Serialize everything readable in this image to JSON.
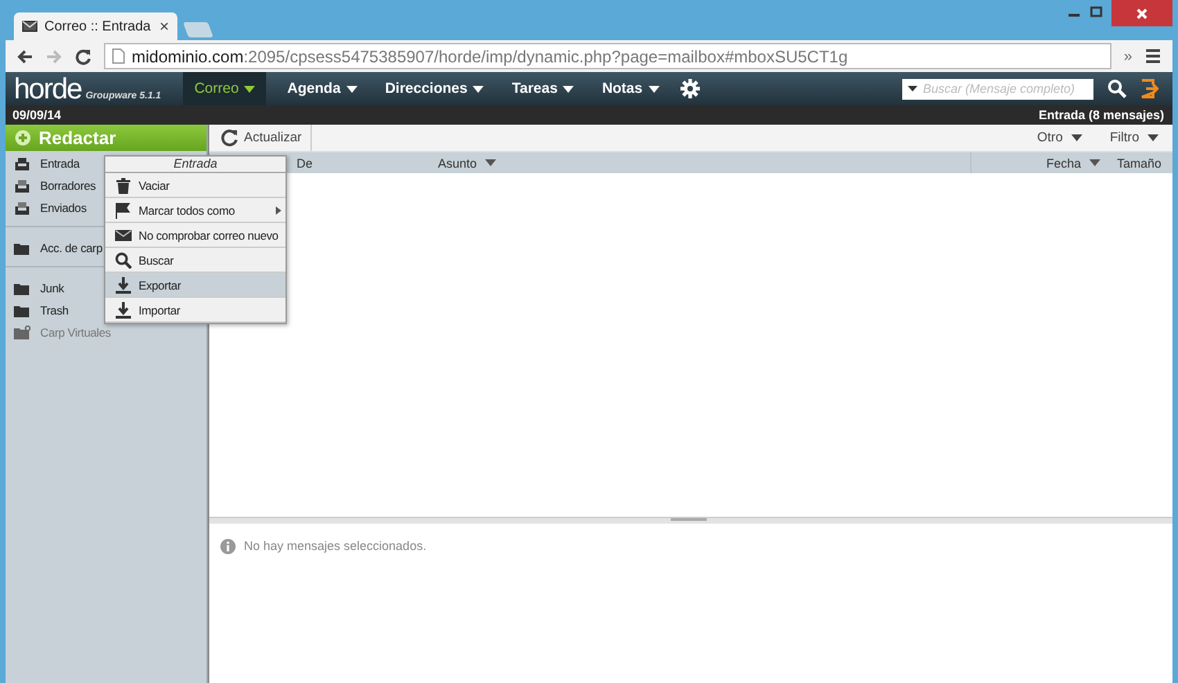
{
  "browser": {
    "tab": {
      "title": "Correo :: Entrada",
      "close": "×"
    },
    "address": {
      "host": "midominio.com",
      "path": ":2095/cpsess5475385907/horde/imp/dynamic.php?page=mailbox#mboxSU5CT1g"
    },
    "extension": "»"
  },
  "header": {
    "logo": "horde",
    "edition": "Groupware 5.1.1",
    "nav": [
      {
        "label": "Correo",
        "selected": true
      },
      {
        "label": "Agenda",
        "selected": false
      },
      {
        "label": "Direcciones",
        "selected": false
      },
      {
        "label": "Tareas",
        "selected": false
      },
      {
        "label": "Notas",
        "selected": false
      }
    ],
    "search": {
      "placeholder": "Buscar (Mensaje completo)"
    }
  },
  "date_bar": {
    "date": "09/09/14",
    "mailbox": "Entrada (8 mensajes)"
  },
  "sidebar": {
    "compose": "Redactar",
    "groups": [
      [
        {
          "label": "Entrada",
          "disabled": false
        },
        {
          "label": "Borradores",
          "disabled": false
        },
        {
          "label": "Enviados",
          "disabled": false
        }
      ],
      [
        {
          "label": "Acc. de carp",
          "disabled": false
        }
      ],
      [
        {
          "label": "Junk",
          "disabled": false
        },
        {
          "label": "Trash",
          "disabled": false
        },
        {
          "label": "Carp Virtuales",
          "disabled": true
        }
      ]
    ]
  },
  "toolbar": {
    "refresh": "Actualizar",
    "other": "Otro",
    "filter": "Filtro"
  },
  "table": {
    "columns": [
      {
        "label": "De",
        "sort": false
      },
      {
        "label": "Asunto",
        "sort": true
      },
      {
        "label": "Fecha",
        "sort": true
      },
      {
        "label": "Tamaño",
        "sort": false
      }
    ]
  },
  "preview": {
    "message": "No hay mensajes seleccionados."
  },
  "context_menu": {
    "title": "Entrada",
    "items": [
      {
        "label": "Vaciar",
        "submenu": false,
        "highlighted": false
      },
      {
        "label": "Marcar todos como",
        "submenu": true,
        "highlighted": false
      },
      {
        "label": "No comprobar correo nuevo",
        "submenu": false,
        "highlighted": false
      },
      {
        "label": "Buscar",
        "submenu": false,
        "highlighted": false
      },
      {
        "label": "Exportar",
        "submenu": false,
        "highlighted": true
      },
      {
        "label": "Importar",
        "submenu": false,
        "highlighted": false
      }
    ]
  }
}
